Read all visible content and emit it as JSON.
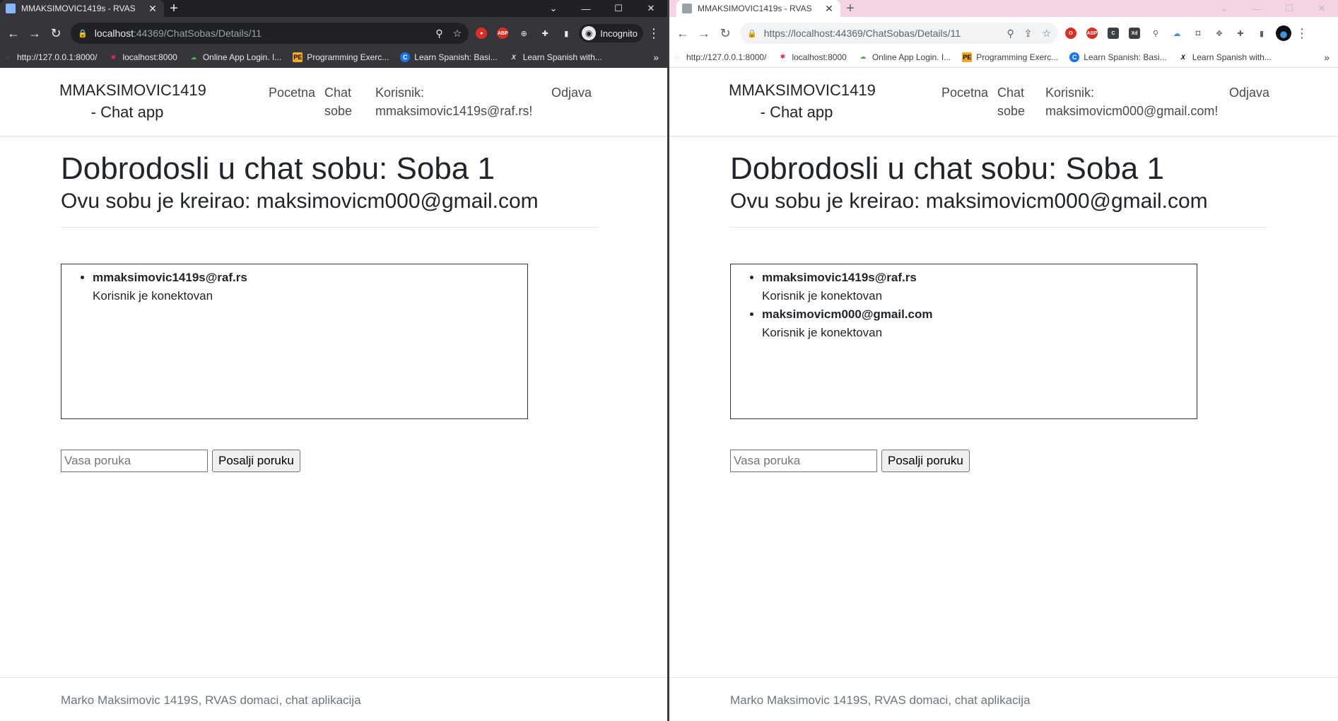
{
  "left": {
    "tab_title": "MMAKSIMOVIC1419s - RVAS",
    "url_host": "localhost",
    "url_rest": ":44369/ChatSobas/Details/11",
    "incognito_label": "Incognito",
    "bookmarks": [
      "http://127.0.0.1:8000/",
      "localhost:8000",
      "Online App Login. I...",
      "Programming Exerc...",
      "Learn Spanish: Basi...",
      "Learn Spanish with..."
    ],
    "brand": "MMAKSIMOVIC1419 - Chat app",
    "nav": {
      "home": "Pocetna",
      "rooms": "Chat sobe",
      "user_label": "Korisnik:",
      "user_email": "mmaksimovic1419s@raf.rs!",
      "logout": "Odjava"
    },
    "heading": "Dobrodosli u chat sobu: Soba 1",
    "subheading": "Ovu sobu je kreirao: maksimovicm000@gmail.com",
    "users": [
      {
        "name": "mmaksimovic1419s@raf.rs",
        "status": "Korisnik je konektovan"
      }
    ],
    "message_placeholder": "Vasa poruka",
    "send_label": "Posalji poruku",
    "footer": "Marko Maksimovic 1419S, RVAS domaci, chat aplikacija"
  },
  "right": {
    "tab_title": "MMAKSIMOVIC1419s - RVAS",
    "url": "https://localhost:44369/ChatSobas/Details/11",
    "bookmarks": [
      "http://127.0.0.1:8000/",
      "localhost:8000",
      "Online App Login. I...",
      "Programming Exerc...",
      "Learn Spanish: Basi...",
      "Learn Spanish with..."
    ],
    "brand": "MMAKSIMOVIC1419 - Chat app",
    "nav": {
      "home": "Pocetna",
      "rooms": "Chat sobe",
      "user_label": "Korisnik:",
      "user_email": "maksimovicm000@gmail.com!",
      "logout": "Odjava"
    },
    "heading": "Dobrodosli u chat sobu: Soba 1",
    "subheading": "Ovu sobu je kreirao: maksimovicm000@gmail.com",
    "users": [
      {
        "name": "mmaksimovic1419s@raf.rs",
        "status": "Korisnik je konektovan"
      },
      {
        "name": "maksimovicm000@gmail.com",
        "status": "Korisnik je konektovan"
      }
    ],
    "message_placeholder": "Vasa poruka",
    "send_label": "Posalji poruku",
    "footer": "Marko Maksimovic 1419S, RVAS domaci, chat aplikacija"
  },
  "icons": {
    "back": "arrow-left-icon",
    "forward": "arrow-right-icon",
    "reload": "reload-icon",
    "lock": "lock-icon",
    "zoom": "zoom-icon",
    "bookmark_star": "star-icon",
    "extensions": "puzzle-icon",
    "menu": "kebab-menu-icon"
  }
}
